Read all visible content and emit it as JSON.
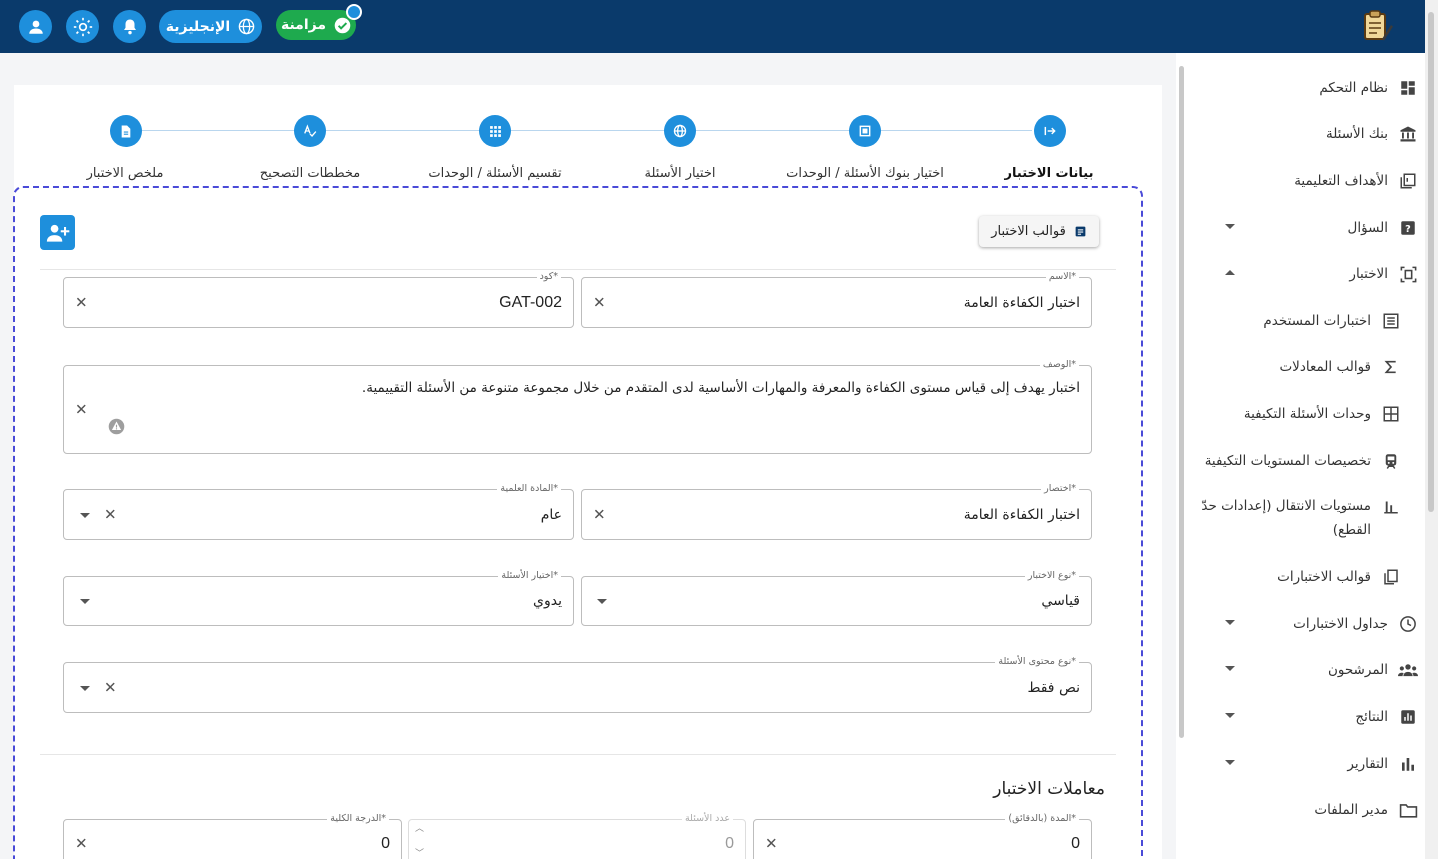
{
  "header": {
    "language_label": "الإنجليزية",
    "sync_label": "مزامنة",
    "icons": [
      "profile-icon",
      "theme-sun-icon",
      "bell-icon",
      "globe-icon",
      "check-icon"
    ]
  },
  "sidebar": {
    "items": [
      {
        "label": "نظام التحكم",
        "icon": "dashboard-icon"
      },
      {
        "label": "بنك الأسئلة",
        "icon": "bank-icon"
      },
      {
        "label": "الأهداف التعليمية",
        "icon": "book-icon"
      },
      {
        "label": "السؤال",
        "icon": "question-icon"
      },
      {
        "label": "الاختبار",
        "icon": "exam-icon"
      },
      {
        "label": "اختبارات المستخدم",
        "icon": "list-icon"
      },
      {
        "label": "قوالب المعادلات",
        "icon": "sigma-icon"
      },
      {
        "label": "وحدات الأسئلة التكيفية",
        "icon": "grid-icon"
      },
      {
        "label": "تخصيصات المستويات التكيفية",
        "icon": "train-icon"
      },
      {
        "label": "مستويات الانتقال (إعدادات حدّ القطع)",
        "icon": "bar-chart-icon"
      },
      {
        "label": "قوالب الاختبارات",
        "icon": "copy-icon"
      },
      {
        "label": "جداول الاختبارات",
        "icon": "clock-icon"
      },
      {
        "label": "المرشحون",
        "icon": "group-icon"
      },
      {
        "label": "النتائج",
        "icon": "results-icon"
      },
      {
        "label": "التقارير",
        "icon": "reports-icon"
      },
      {
        "label": "مدير الملفات",
        "icon": "folder-icon"
      }
    ]
  },
  "stepper": {
    "steps": [
      {
        "label": "بيانات الاختبار",
        "active": true
      },
      {
        "label": "اختيار بنوك الأسئلة / الوحدات",
        "active": false
      },
      {
        "label": "اختيار الأسئلة",
        "active": false
      },
      {
        "label": "تقسيم الأسئلة / الوحدات",
        "active": false
      },
      {
        "label": "مخططات التصحيح",
        "active": false
      },
      {
        "label": "ملخص الاختبار",
        "active": false
      }
    ]
  },
  "form": {
    "templates_button": "قوالب الاختبار",
    "name": {
      "label": "الاسم*",
      "value": "اختبار الكفاءة العامة"
    },
    "code": {
      "label": "كود*",
      "value": "GAT-002"
    },
    "description": {
      "label": "الوصف*",
      "value": "اختبار يهدف إلى قياس مستوى الكفاءة والمعرفة والمهارات الأساسية لدى المتقدم من خلال مجموعة متنوعة من الأسئلة التقييمية."
    },
    "abbreviation": {
      "label": "اختصار*",
      "value": "اختبار الكفاءة العامة"
    },
    "subject": {
      "label": "المادة العلمية*",
      "value": "عام"
    },
    "exam_type": {
      "label": "نوع الاختبار*",
      "value": "قياسي"
    },
    "question_selection": {
      "label": "اختيار الأسئلة*",
      "value": "يدوي"
    },
    "content_type": {
      "label": "نوع محتوى الأسئلة*",
      "value": "نص فقط"
    },
    "params_title": "معاملات الاختبار",
    "duration": {
      "label": "المدة (بالدقائق)*",
      "value": "0"
    },
    "question_count": {
      "label": "عدد الأسئلة",
      "value": "0"
    },
    "total_grade": {
      "label": "الدرجة الكلية*",
      "value": "0"
    }
  },
  "colors": {
    "header_bg": "#0a3a6b",
    "accent": "#1e8fdc",
    "sync_green": "#1eaa4e",
    "dash_border": "#4a4ad8"
  }
}
